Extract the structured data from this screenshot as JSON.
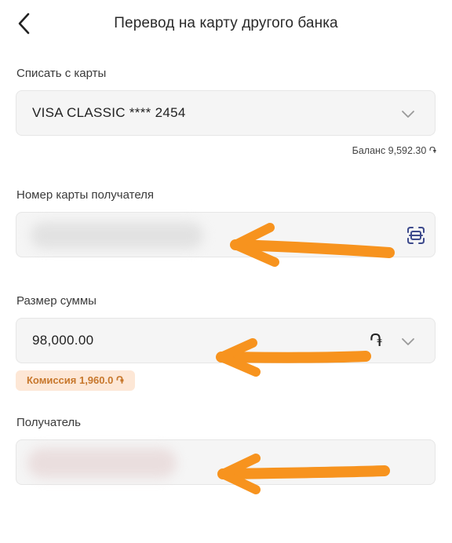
{
  "header": {
    "title": "Перевод на карту другого банка"
  },
  "debit_card": {
    "label": "Списать с карты",
    "value": "VISA CLASSIC **** 2454",
    "balance": "Баланс 9,592.30 ֏"
  },
  "recipient_card": {
    "label": "Номер карты получателя",
    "icon": "scan-icon"
  },
  "amount": {
    "label": "Размер суммы",
    "value": "98,000.00",
    "currency_symbol": "֏",
    "commission": "Комиссия 1,960.0 ֏"
  },
  "recipient": {
    "label": "Получатель"
  },
  "colors": {
    "annotation_arrow": "#f7931e",
    "commission_bg": "#fde7d6",
    "commission_text": "#c7772c",
    "field_bg": "#f5f5f5",
    "accent_icon": "#3d4a8c"
  }
}
